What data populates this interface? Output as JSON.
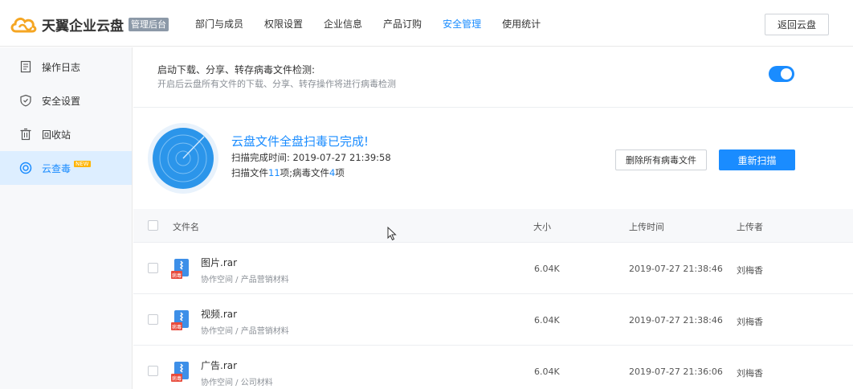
{
  "app": {
    "name": "天翼企业云盘",
    "badge": "管理后台",
    "back_label": "返回云盘"
  },
  "nav": [
    {
      "label": "部门与成员",
      "active": false
    },
    {
      "label": "权限设置",
      "active": false
    },
    {
      "label": "企业信息",
      "active": false
    },
    {
      "label": "产品订购",
      "active": false
    },
    {
      "label": "安全管理",
      "active": true
    },
    {
      "label": "使用统计",
      "active": false
    }
  ],
  "sidebar": {
    "items": [
      {
        "label": "操作日志",
        "icon": "log-icon"
      },
      {
        "label": "安全设置",
        "icon": "shield-icon"
      },
      {
        "label": "回收站",
        "icon": "trash-icon"
      },
      {
        "label": "云查毒",
        "icon": "scan-icon",
        "active": true,
        "badge": "NEW"
      }
    ]
  },
  "virus_check": {
    "title": "启动下载、分享、转存病毒文件检测:",
    "description": "开启后云盘所有文件的下载、分享、转存操作将进行病毒检测",
    "enabled": true
  },
  "scan": {
    "title": "云盘文件全盘扫毒已完成!",
    "time_label": "扫描完成时间:",
    "time_value": "2019-07-27 21:39:58",
    "files_prefix": "扫描文件",
    "files_count": "11",
    "files_mid": "项;病毒文件",
    "virus_count": "4",
    "files_suffix": "项",
    "delete_all_label": "删除所有病毒文件",
    "rescan_label": "重新扫描"
  },
  "table": {
    "columns": {
      "name": "文件名",
      "size": "大小",
      "time": "上传时间",
      "owner": "上传者"
    },
    "rows": [
      {
        "name": "图片.rar",
        "path": "协作空间 / 产品营销材料",
        "size": "6.04K",
        "time": "2019-07-27 21:38:46",
        "owner": "刘梅香"
      },
      {
        "name": "视频.rar",
        "path": "协作空间 / 产品营销材料",
        "size": "6.04K",
        "time": "2019-07-27 21:38:46",
        "owner": "刘梅香"
      },
      {
        "name": "广告.rar",
        "path": "协作空间 / 公司材料",
        "size": "6.04K",
        "time": "2019-07-27 21:36:06",
        "owner": "刘梅香"
      }
    ],
    "virus_tag": "病毒"
  },
  "colors": {
    "accent": "#1a8cff",
    "virus": "#e84c3d"
  }
}
